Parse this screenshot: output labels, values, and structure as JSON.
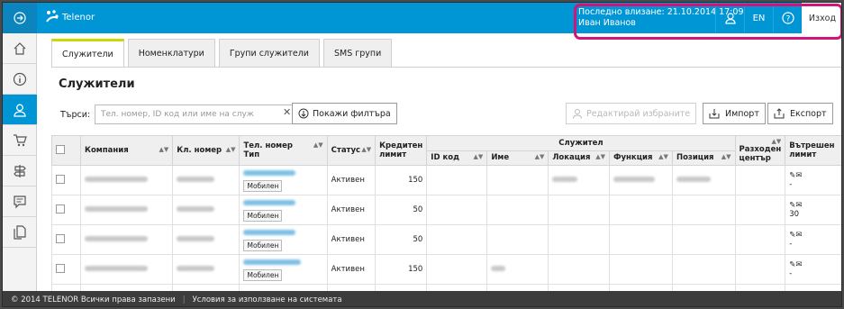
{
  "app": {
    "logo_text": "Telenor"
  },
  "user": {
    "last_login": "Последно влизане: 21.10.2014 17:09",
    "name": "Иван Иванов",
    "lang": "EN",
    "logout": "Изход"
  },
  "tabs": [
    {
      "label": "Служители"
    },
    {
      "label": "Номенклатури"
    },
    {
      "label": "Групи служители"
    },
    {
      "label": "SMS групи"
    }
  ],
  "page": {
    "title": "Служители"
  },
  "search": {
    "label": "Търси:",
    "placeholder": "Тел. номер, ID код или име на служ"
  },
  "toolbar": {
    "filters": "Покажи филтъра",
    "edit_selected": "Редактирай избраните",
    "import": "Импорт",
    "export": "Експорт"
  },
  "table": {
    "headers": {
      "company": "Компания",
      "client_no": "Кл. номер",
      "phone": "Тел. номер",
      "type": "Тип",
      "status": "Статус",
      "credit": "Кредитен лимит",
      "employee": "Служител",
      "id": "ID код",
      "name": "Име",
      "location": "Локация",
      "function": "Функция",
      "position": "Позиция",
      "cost_center": "Разходен център",
      "internal": "Вътрешен лимит"
    },
    "rows": [
      {
        "type": "Мобилен",
        "status": "Активен",
        "credit": "150",
        "internal": "-"
      },
      {
        "type": "Мобилен",
        "status": "Активен",
        "credit": "50",
        "internal": "30"
      },
      {
        "type": "Мобилен",
        "status": "Активен",
        "credit": "50",
        "internal": "-"
      },
      {
        "type": "Мобилен",
        "status": "Активен",
        "credit": "150",
        "internal": "-"
      }
    ]
  },
  "footer": {
    "copyright": "© 2014 TELENOR Всички права запазени",
    "terms": "Условия за използване на системата"
  },
  "colors": {
    "brand": "#0096d6",
    "highlight": "#d2147a",
    "tab_accent": "#ccd900"
  }
}
